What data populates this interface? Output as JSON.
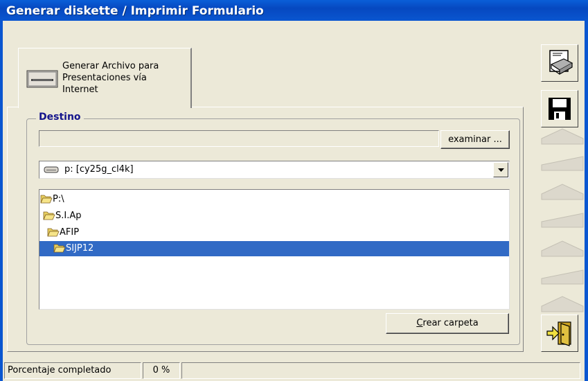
{
  "window": {
    "title": "Generar diskette / Imprimir Formulario"
  },
  "tab": {
    "label_line1": "Generar Archivo para",
    "label_line2": "Presentaciones vía",
    "label_line3": "Internet",
    "icon": "floppy-drive-icon"
  },
  "destino": {
    "legend": "Destino",
    "path_value": "",
    "examinar_label": "examinar ...",
    "drive": {
      "icon": "drive-icon",
      "selected": "p: [cy25g_cl4k]"
    },
    "folders": [
      {
        "label": "P:\\",
        "icon": "open-folder-icon",
        "selected": false
      },
      {
        "label": "S.I.Ap",
        "icon": "open-folder-icon",
        "selected": false
      },
      {
        "label": "AFIP",
        "icon": "open-folder-icon",
        "selected": false
      },
      {
        "label": "SIJP12",
        "icon": "open-folder-icon",
        "selected": true
      }
    ],
    "crear_label": "Crear carpeta",
    "crear_accel": "C"
  },
  "sidebar": {
    "buttons": [
      {
        "icon": "print-icon"
      },
      {
        "icon": "save-icon"
      },
      {
        "icon": "exit-door-icon"
      }
    ]
  },
  "status": {
    "progress_label": "Porcentaje completado",
    "progress_value": "0 %",
    "progress_fraction": 0
  },
  "colors": {
    "titlebar": "#0a56d0",
    "selection": "#316ac5",
    "legend": "#14148c",
    "background": "#ece9d8"
  }
}
